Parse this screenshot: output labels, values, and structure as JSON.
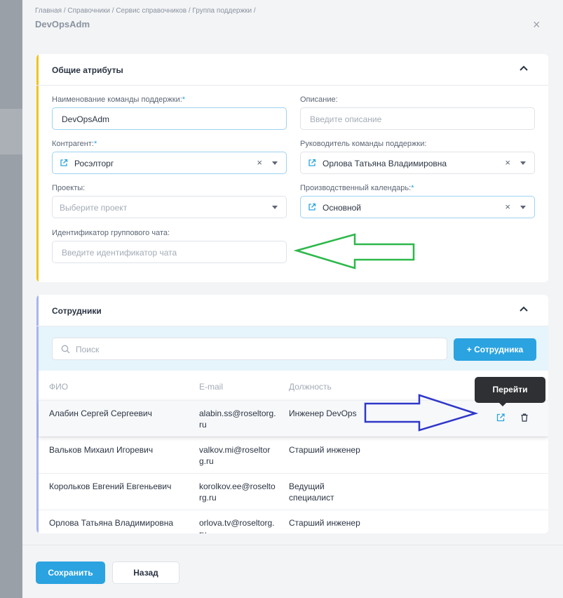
{
  "breadcrumbs": "Главная / Справочники / Сервис справочников / Группа поддержки /",
  "page_title": "DevOpsAdm",
  "close_label": "×",
  "general": {
    "title": "Общие атрибуты",
    "name_label": "Наименование команды поддержки:",
    "name_value": "DevOpsAdm",
    "desc_label": "Описание:",
    "desc_placeholder": "Введите описание",
    "contractor_label": "Контрагент:",
    "contractor_value": "Росэлторг",
    "leader_label": "Руководитель команды поддержки:",
    "leader_value": "Орлова Татьяна Владимировна",
    "projects_label": "Проекты:",
    "projects_placeholder": "Выберите проект",
    "calendar_label": "Производственный календарь:",
    "calendar_value": "Основной",
    "chat_label": "Идентификатор группового чата:",
    "chat_placeholder": "Введите идентификатор чата",
    "required_mark": "*",
    "clear_mark": "×"
  },
  "employees": {
    "title": "Сотрудники",
    "search_placeholder": "Поиск",
    "add_button": "+ Сотрудника",
    "columns": [
      "ФИО",
      "E-mail",
      "Должность"
    ],
    "rows": [
      {
        "name": "Алабин Сергей Сергеевич",
        "email": "alabin.ss@roseltorg.ru",
        "position": "Инженер DevOps"
      },
      {
        "name": "Вальков Михаил Игоревич",
        "email": "valkov.mi@roseltorg.ru",
        "position": "Старший инженер"
      },
      {
        "name": "Корольков Евгений Евгеньевич",
        "email": "korolkov.ee@roseltorg.ru",
        "position": "Ведущий специалист"
      },
      {
        "name": "Орлова Татьяна Владимировна",
        "email": "orlova.tv@roseltorg.ru",
        "position": "Старший инженер"
      }
    ],
    "tooltip": "Перейти"
  },
  "footer": {
    "save": "Сохранить",
    "back": "Назад"
  },
  "colors": {
    "accent": "#2aa3e0",
    "general_bar": "#f0c419",
    "employees_bar": "#a9b4f0",
    "green_arrow": "#2db84a",
    "blue_arrow": "#2f37c8"
  },
  "icons": [
    "chevron-up-icon",
    "external-link-icon",
    "search-icon",
    "trash-icon",
    "close-icon",
    "caret-down-icon"
  ]
}
